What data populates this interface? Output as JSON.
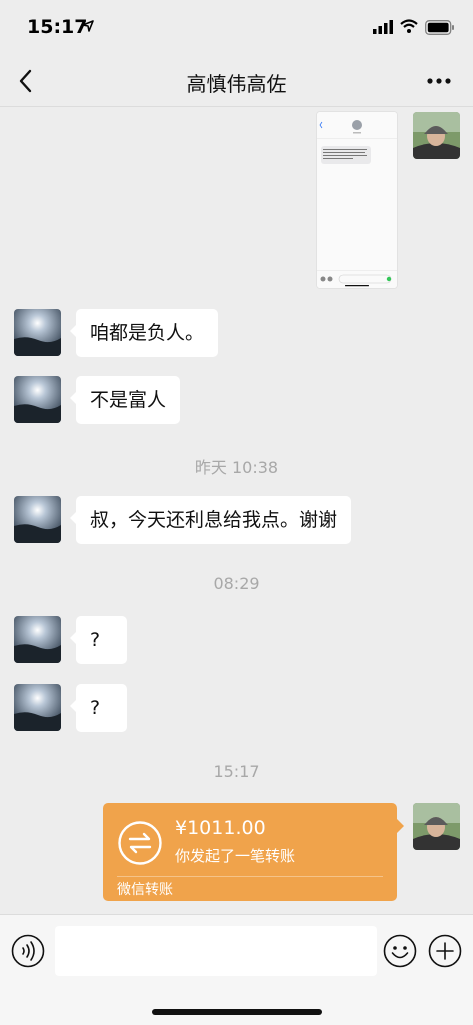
{
  "status_bar": {
    "time": "15:17"
  },
  "header": {
    "title": "高慎伟高佐"
  },
  "messages": {
    "m1": "咱都是负人。",
    "m2": "不是富人",
    "m3": "叔，今天还利息给我点。谢谢",
    "m4": "?",
    "m5": "?"
  },
  "timestamps": {
    "t1": "昨天 10:38",
    "t2": "08:29",
    "t3": "15:17"
  },
  "transfer": {
    "amount": "¥1011.00",
    "description": "你发起了一笔转账",
    "footer": "微信转账"
  },
  "colors": {
    "background": "#ededed",
    "transfer_card": "#f0a34b",
    "timestamp": "#a8a8a8"
  }
}
